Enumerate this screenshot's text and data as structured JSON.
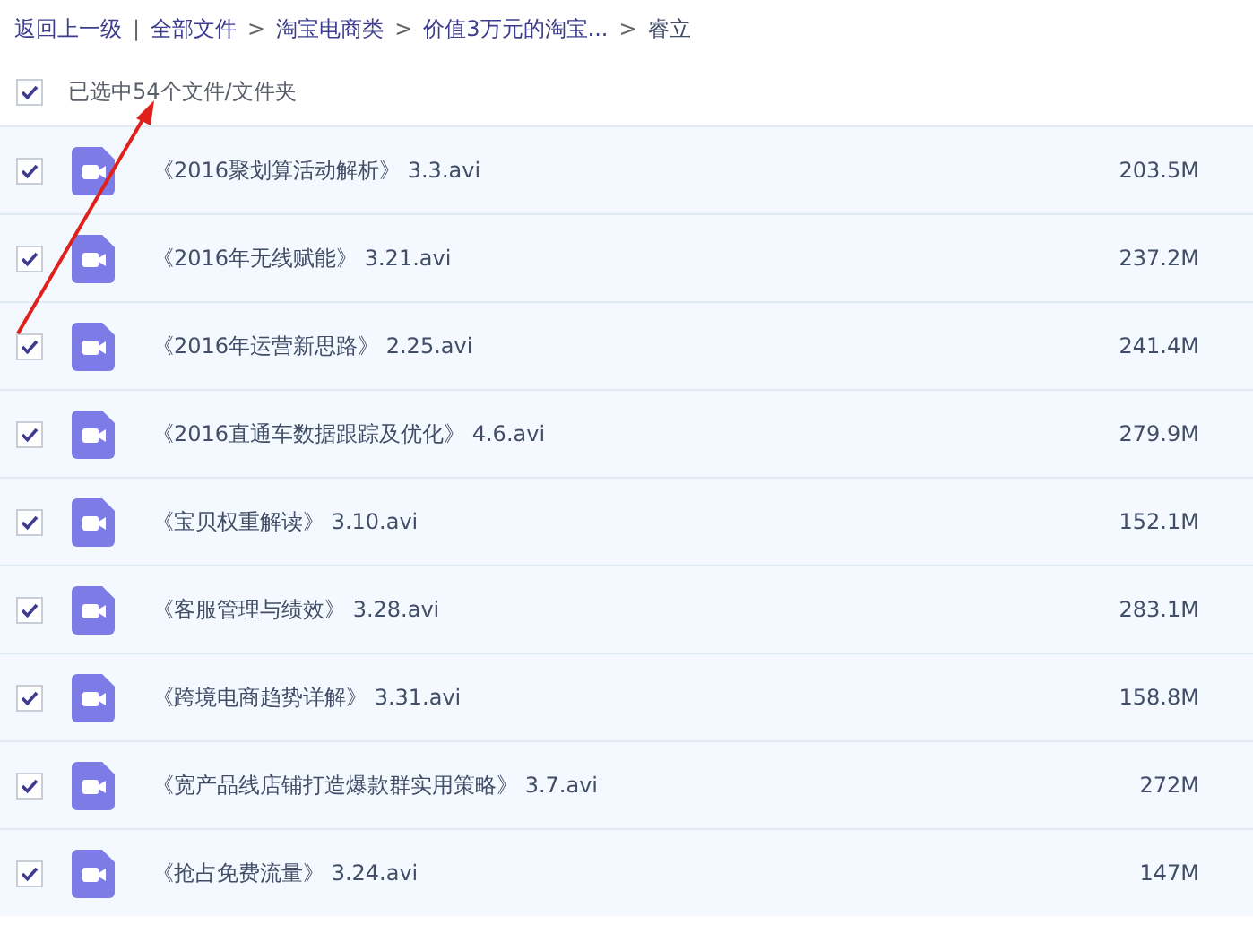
{
  "breadcrumb": {
    "back": "返回上一级",
    "separator": "|",
    "items": [
      {
        "label": "全部文件",
        "link": true
      },
      {
        "label": "淘宝电商类",
        "link": true
      },
      {
        "label": "价值3万元的淘宝...",
        "link": true
      },
      {
        "label": "睿立",
        "link": false
      }
    ],
    "arrow": ">"
  },
  "select_all": {
    "checked": true,
    "label": "已选中54个文件/文件夹"
  },
  "files": [
    {
      "name": "《2016聚划算活动解析》 3.3.avi",
      "size": "203.5M",
      "checked": true
    },
    {
      "name": "《2016年无线赋能》 3.21.avi",
      "size": "237.2M",
      "checked": true
    },
    {
      "name": "《2016年运营新思路》 2.25.avi",
      "size": "241.4M",
      "checked": true
    },
    {
      "name": "《2016直通车数据跟踪及优化》 4.6.avi",
      "size": "279.9M",
      "checked": true
    },
    {
      "name": "《宝贝权重解读》 3.10.avi",
      "size": "152.1M",
      "checked": true
    },
    {
      "name": "《客服管理与绩效》 3.28.avi",
      "size": "283.1M",
      "checked": true
    },
    {
      "name": "《跨境电商趋势详解》 3.31.avi",
      "size": "158.8M",
      "checked": true
    },
    {
      "name": "《宽产品线店铺打造爆款群实用策略》 3.7.avi",
      "size": "272M",
      "checked": true
    },
    {
      "name": "《抢占免费流量》 3.24.avi",
      "size": "147M",
      "checked": true
    }
  ]
}
